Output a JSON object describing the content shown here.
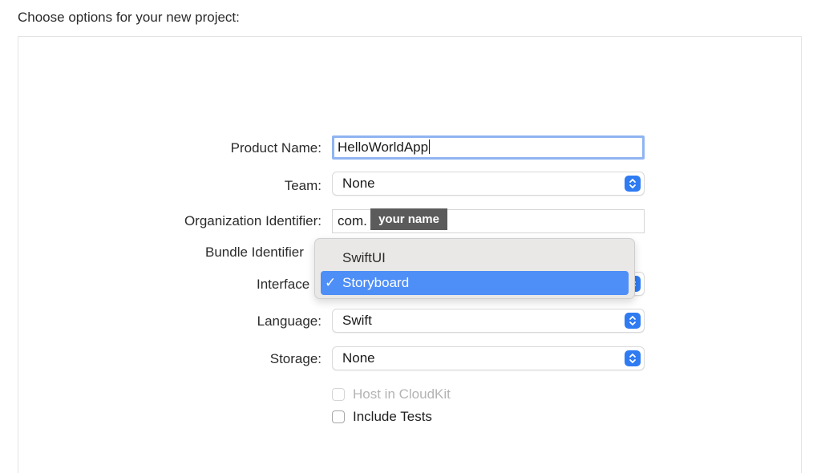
{
  "heading": "Choose options for your new project:",
  "form": {
    "product_name": {
      "label": "Product Name:",
      "value": "HelloWorldApp"
    },
    "team": {
      "label": "Team:",
      "value": "None"
    },
    "organization_identifier": {
      "label": "Organization Identifier:",
      "value": "com."
    },
    "bundle_identifier": {
      "label": "Bundle Identifier"
    },
    "interface": {
      "label": "Interface"
    },
    "language": {
      "label": "Language:",
      "value": "Swift"
    },
    "storage": {
      "label": "Storage:",
      "value": "None"
    },
    "host_in_cloudkit": {
      "label": "Host in CloudKit",
      "checked": false,
      "enabled": false
    },
    "include_tests": {
      "label": "Include Tests",
      "checked": false,
      "enabled": true
    }
  },
  "tooltip": {
    "text": "your name"
  },
  "interface_menu": {
    "items": [
      {
        "label": "SwiftUI",
        "selected": false
      },
      {
        "label": "Storyboard",
        "selected": true
      }
    ],
    "check_glyph": "✓"
  },
  "icons": {
    "stepper": "chevron-up-down-icon",
    "checkmark": "checkmark-icon"
  },
  "colors": {
    "accent": "#2f7bf2",
    "menu_selection": "#4e8ef7",
    "focus_ring": "#8fb4f2",
    "tooltip_bg": "#5b5b5b"
  }
}
